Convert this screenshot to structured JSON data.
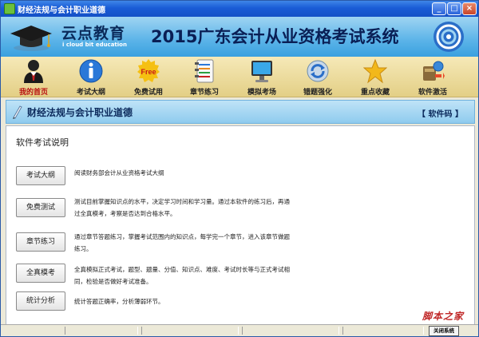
{
  "window": {
    "title": "财经法规与会计职业道德"
  },
  "banner": {
    "brand": "云点教育",
    "brand_sub": "i cloud bit education",
    "system_title": "2015广东会计从业资格考试系统"
  },
  "toolbar": {
    "items": [
      {
        "label": "我的首页",
        "icon": "user-icon"
      },
      {
        "label": "考试大纲",
        "icon": "info-icon"
      },
      {
        "label": "免费试用",
        "icon": "free-badge-icon"
      },
      {
        "label": "章节练习",
        "icon": "notebook-icon"
      },
      {
        "label": "模拟考场",
        "icon": "monitor-icon"
      },
      {
        "label": "错题强化",
        "icon": "refresh-icon"
      },
      {
        "label": "重点收藏",
        "icon": "star-icon"
      },
      {
        "label": "软件激活",
        "icon": "key-activate-icon"
      }
    ]
  },
  "section": {
    "title": "财经法规与会计职业道德",
    "code_label": "【 软件码 】"
  },
  "content": {
    "heading": "软件考试说明",
    "rows": [
      {
        "button": "考试大纲",
        "desc": "阅读财务部会计从业资格考试大纲"
      },
      {
        "button": "免费测试",
        "desc": "测试目前掌握知识点的水平，决定学习时间和学习量。通过本软件的练习后，再通过全真模考，考察是否达到合格水平。"
      },
      {
        "button": "章节练习",
        "desc": "通过章节答题练习，掌握考试范围内的知识点，每学完一个章节，进入该章节做题练习。"
      },
      {
        "button": "全真模考",
        "desc": "全真模拟正式考试，题型、题量、分值、知识点、难度、考试时长等与正式考试相同，检验是否做好考试准备。"
      },
      {
        "button": "统计分析",
        "desc": "统计答题正确率，分析薄弱环节。"
      }
    ]
  },
  "status": {
    "button": "关闭系统"
  },
  "watermark": "脚本之家",
  "colors": {
    "accent": "#1450c6",
    "banner": "#5ab3e8",
    "toolbar": "#e3cf86",
    "active_label": "#b81010"
  }
}
